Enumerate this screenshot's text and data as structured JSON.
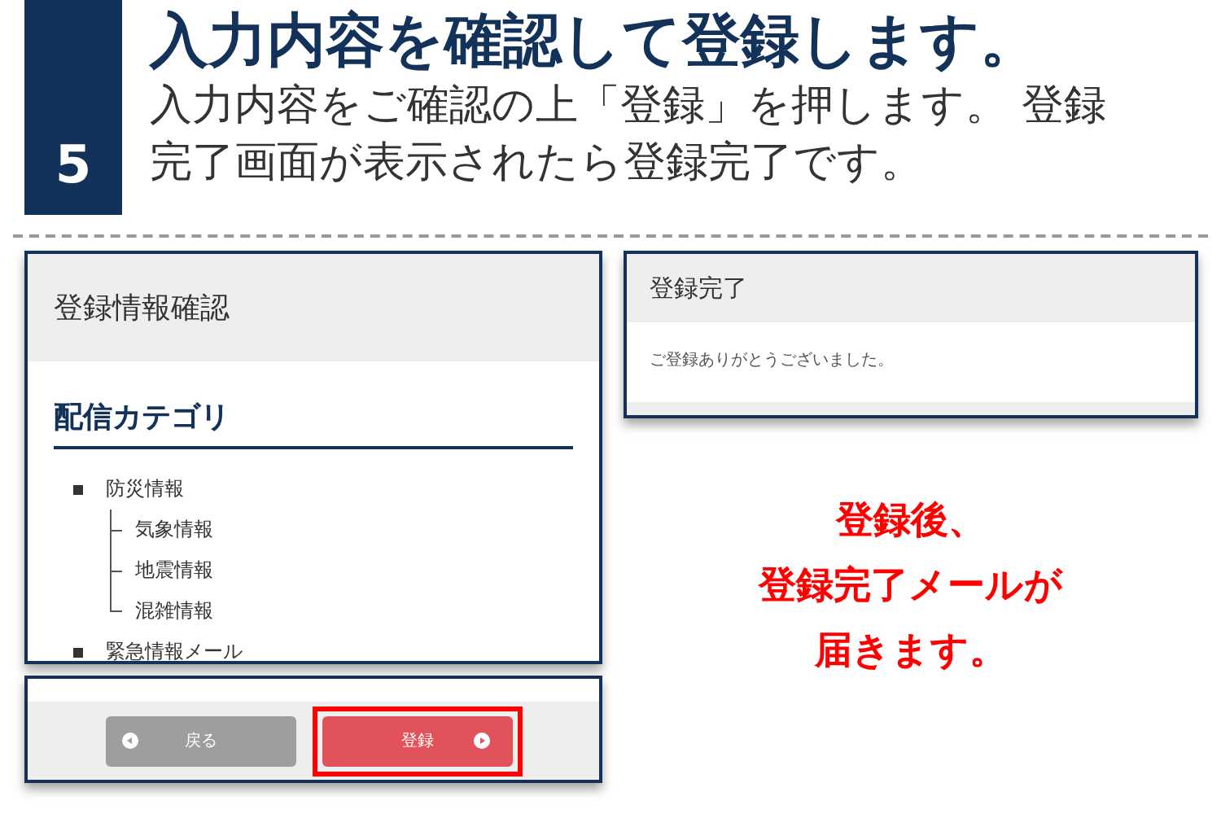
{
  "step": {
    "number": "5",
    "title": "入力内容を確認して登録します。",
    "description": "入力内容をご確認の上「登録」を押します。 登録完了画面が表示されたら登録完了です。"
  },
  "confirm_screen": {
    "title": "登録情報確認",
    "section": "配信カテゴリ",
    "categories": [
      {
        "label": "防災情報",
        "children": [
          {
            "label": "気象情報"
          },
          {
            "label": "地震情報"
          },
          {
            "label": "混雑情報"
          }
        ]
      },
      {
        "label": "緊急情報メール"
      }
    ]
  },
  "button_screen": {
    "buttons": [
      {
        "label": "戻る",
        "kind": "back",
        "highlighted": false
      },
      {
        "label": "登録",
        "kind": "submit",
        "highlighted": true
      }
    ]
  },
  "complete_screen": {
    "title": "登録完了",
    "message": "ご登録ありがとうございました。"
  },
  "note": [
    "登録後、",
    "登録完了メールが",
    "届きます。"
  ]
}
